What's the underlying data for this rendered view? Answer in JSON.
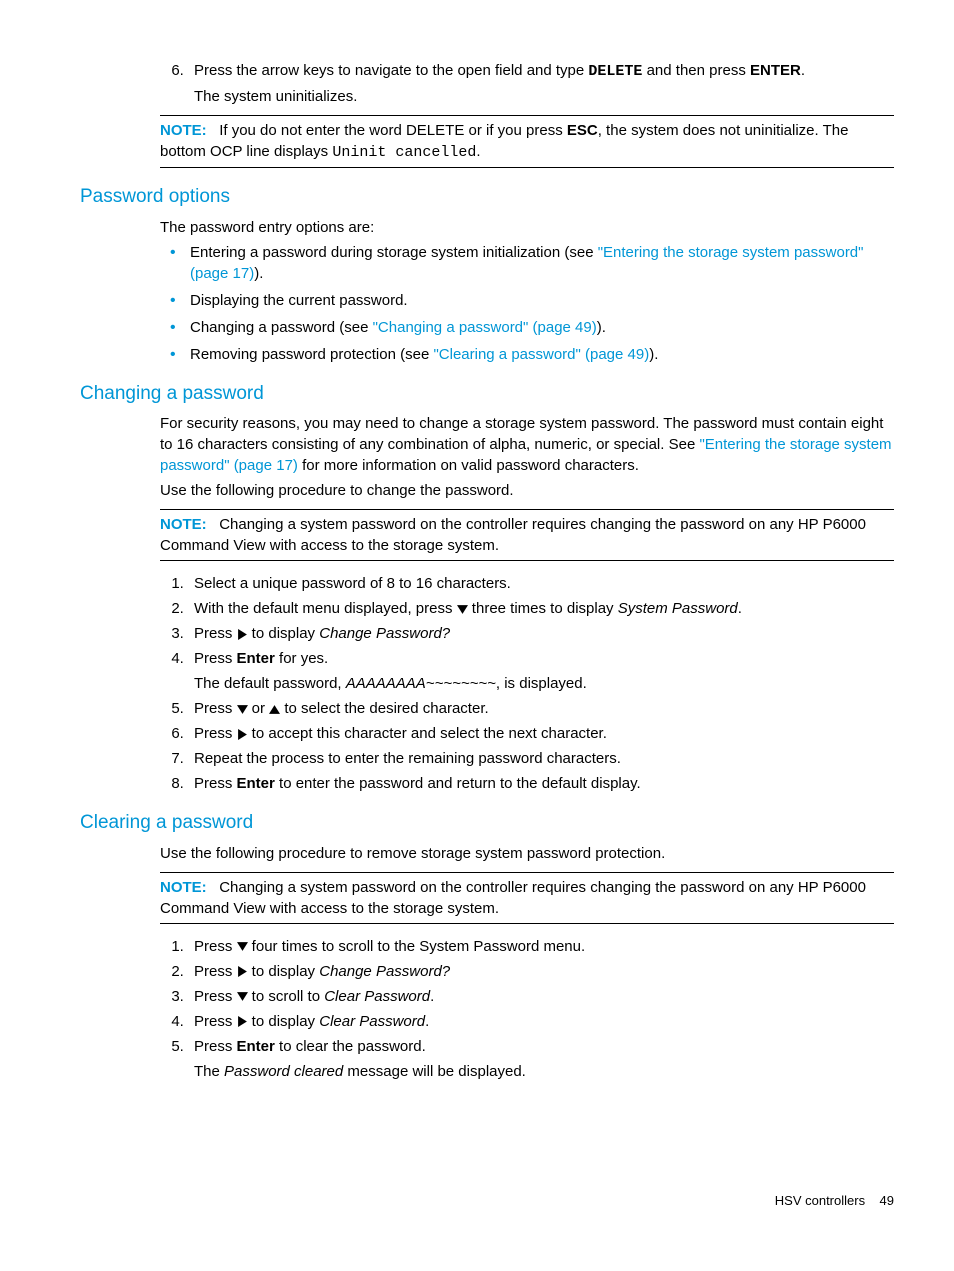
{
  "step6": {
    "num": "6.",
    "text_pre": "Press the arrow keys to navigate to the open field and type ",
    "delete_cmd": "DELETE",
    "text_mid": " and then press ",
    "enter_key": "ENTER",
    "text_post": ".",
    "result": "The system uninitializes."
  },
  "note1": {
    "label": "NOTE:",
    "t1": "If you do not enter the word DELETE or if you press ",
    "esc": "ESC",
    "t2": ", the system does not uninitialize. The bottom OCP line displays ",
    "code": "Uninit cancelled",
    "t3": "."
  },
  "pw_options": {
    "heading": "Password options",
    "intro": "The password entry options are:",
    "b1a": "Entering a password during storage system initialization (see ",
    "b1link": "\"Entering the storage system password\" (page 17)",
    "b1b": ").",
    "b2": "Displaying the current password.",
    "b3a": "Changing a password (see ",
    "b3link": "\"Changing a password\" (page 49)",
    "b3b": ").",
    "b4a": "Removing password protection (see ",
    "b4link": "\"Clearing a password\" (page 49)",
    "b4b": ")."
  },
  "changing": {
    "heading": "Changing a password",
    "p1a": "For security reasons, you may need to change a storage system password. The password must contain eight to 16 characters consisting of any combination of alpha, numeric, or special. See ",
    "p1link": "\"Entering the storage system password\" (page 17)",
    "p1b": " for more information on valid password characters.",
    "p2": "Use the following procedure to change the password.",
    "note_label": "NOTE:",
    "note_text": "Changing a system password on the controller requires changing the password on any HP P6000 Command View with access to the storage system.",
    "s1": "Select a unique password of 8 to 16 characters.",
    "s2a": "With the default menu displayed, press ",
    "s2b": " three times to display ",
    "s2i": "System Password",
    "s2c": ".",
    "s3a": "Press ",
    "s3b": " to display ",
    "s3i": "Change Password?",
    "s4a": "Press ",
    "s4bold": "Enter",
    "s4b": " for yes.",
    "s4sub_a": "The default password, ",
    "s4sub_i": "AAAAAAAA~~~~~~~~",
    "s4sub_b": ", is displayed.",
    "s5a": "Press ",
    "s5b": " or ",
    "s5c": " to select the desired character.",
    "s6a": "Press ",
    "s6b": " to accept this character and select the next character.",
    "s7": "Repeat the process to enter the remaining password characters.",
    "s8a": "Press ",
    "s8bold": "Enter",
    "s8b": " to enter the password and return to the default display."
  },
  "clearing": {
    "heading": "Clearing a password",
    "p1": "Use the following procedure to remove storage system password protection.",
    "note_label": "NOTE:",
    "note_text": "Changing a system password on the controller requires changing the password on any HP P6000 Command View with access to the storage system.",
    "s1a": "Press ",
    "s1b": " four times to scroll to the System Password menu.",
    "s2a": "Press ",
    "s2b": " to display ",
    "s2i": "Change Password?",
    "s3a": "Press ",
    "s3b": " to scroll to ",
    "s3i": "Clear Password",
    "s3c": ".",
    "s4a": "Press ",
    "s4b": " to display ",
    "s4i": "Clear Password",
    "s4c": ".",
    "s5a": "Press ",
    "s5bold": "Enter",
    "s5b": " to clear the password.",
    "s5sub_a": "The ",
    "s5sub_i": "Password cleared",
    "s5sub_b": " message will be displayed."
  },
  "footer": {
    "section": "HSV controllers",
    "page": "49"
  }
}
